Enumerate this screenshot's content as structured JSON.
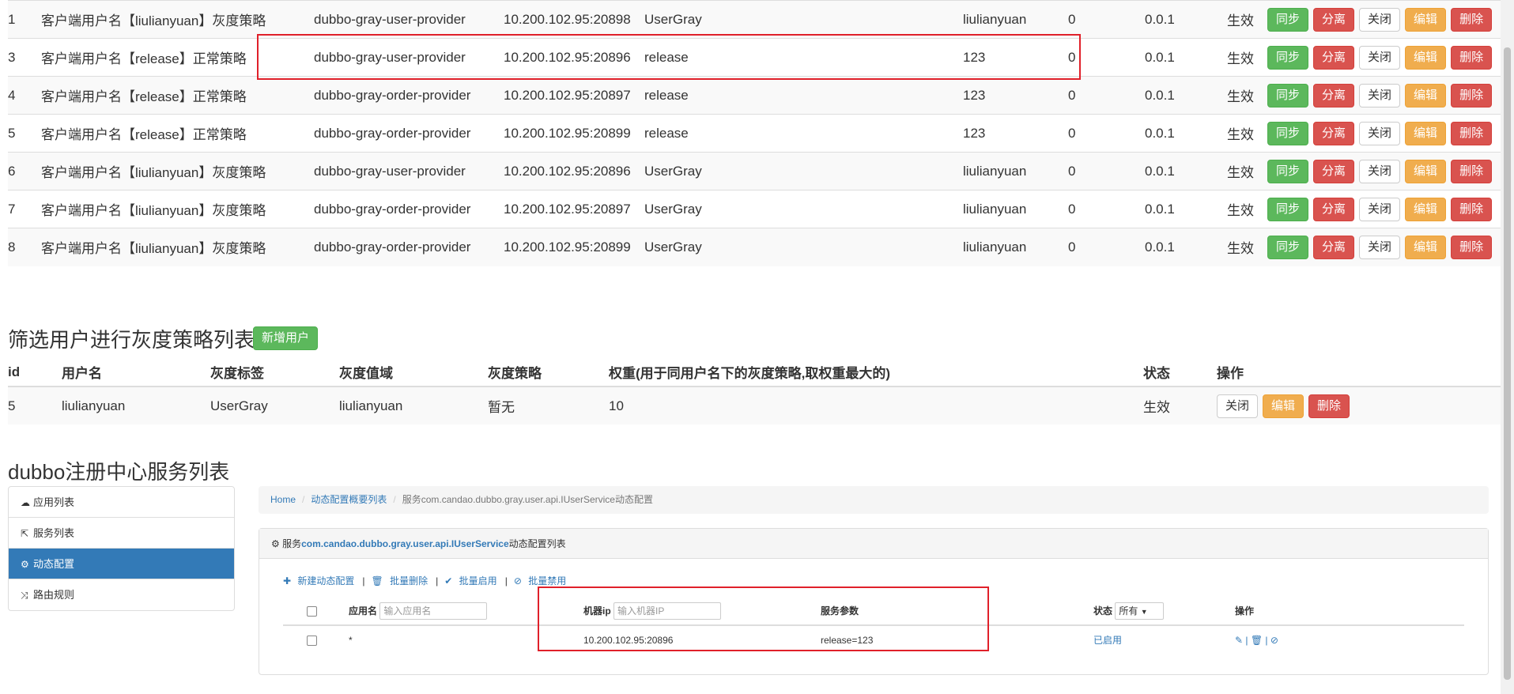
{
  "strategy_rows": [
    {
      "id": "1",
      "name": "客户端用户名【liulianyuan】灰度策略",
      "service": "dubbo-gray-user-provider",
      "address": "10.200.102.95:20898",
      "tag": "UserGray",
      "value": "liulianyuan",
      "weight": "0",
      "version": "0.0.1",
      "status": "生效"
    },
    {
      "id": "3",
      "name": "客户端用户名【release】正常策略",
      "service": "dubbo-gray-user-provider",
      "address": "10.200.102.95:20896",
      "tag": "release",
      "value": "123",
      "weight": "0",
      "version": "0.0.1",
      "status": "生效"
    },
    {
      "id": "4",
      "name": "客户端用户名【release】正常策略",
      "service": "dubbo-gray-order-provider",
      "address": "10.200.102.95:20897",
      "tag": "release",
      "value": "123",
      "weight": "0",
      "version": "0.0.1",
      "status": "生效"
    },
    {
      "id": "5",
      "name": "客户端用户名【release】正常策略",
      "service": "dubbo-gray-order-provider",
      "address": "10.200.102.95:20899",
      "tag": "release",
      "value": "123",
      "weight": "0",
      "version": "0.0.1",
      "status": "生效"
    },
    {
      "id": "6",
      "name": "客户端用户名【liulianyuan】灰度策略",
      "service": "dubbo-gray-user-provider",
      "address": "10.200.102.95:20896",
      "tag": "UserGray",
      "value": "liulianyuan",
      "weight": "0",
      "version": "0.0.1",
      "status": "生效"
    },
    {
      "id": "7",
      "name": "客户端用户名【liulianyuan】灰度策略",
      "service": "dubbo-gray-order-provider",
      "address": "10.200.102.95:20897",
      "tag": "UserGray",
      "value": "liulianyuan",
      "weight": "0",
      "version": "0.0.1",
      "status": "生效"
    },
    {
      "id": "8",
      "name": "客户端用户名【liulianyuan】灰度策略",
      "service": "dubbo-gray-order-provider",
      "address": "10.200.102.95:20899",
      "tag": "UserGray",
      "value": "liulianyuan",
      "weight": "0",
      "version": "0.0.1",
      "status": "生效"
    }
  ],
  "row_actions": {
    "sync": "同步",
    "detach": "分离",
    "close": "关闭",
    "edit": "编辑",
    "delete": "删除"
  },
  "users_section": {
    "title": "筛选用户进行灰度策略列表",
    "add_button": "新增用户",
    "headers": [
      "id",
      "用户名",
      "灰度标签",
      "灰度值域",
      "灰度策略",
      "权重(用于同用户名下的灰度策略,取权重最大的)",
      "状态",
      "操作"
    ],
    "row": {
      "id": "5",
      "username": "liulianyuan",
      "tag": "UserGray",
      "value": "liulianyuan",
      "strategy": "暂无",
      "weight": "10",
      "status": "生效"
    },
    "actions": {
      "close": "关闭",
      "edit": "编辑",
      "delete": "删除"
    }
  },
  "registry_section": {
    "title": "dubbo注册中心服务列表",
    "nav": [
      {
        "icon": "cloud-icon",
        "label": "应用列表"
      },
      {
        "icon": "share-icon",
        "label": "服务列表"
      },
      {
        "icon": "cogs-icon",
        "label": "动态配置",
        "active": true
      },
      {
        "icon": "random-icon",
        "label": "路由规则"
      }
    ],
    "breadcrumb": {
      "home": "Home",
      "overview": "动态配置概要列表",
      "current": "服务com.candao.dubbo.gray.user.api.IUserService动态配置"
    },
    "panel": {
      "title_prefix": "服务",
      "title_service": "com.candao.dubbo.gray.user.api.IUserService",
      "title_suffix": "动态配置列表",
      "tools": {
        "new": "新建动态配置",
        "batch_delete": "批量删除",
        "batch_enable": "批量启用",
        "batch_disable": "批量禁用"
      },
      "headers": {
        "app": "应用名",
        "app_placeholder": "输入应用名",
        "ip": "机器ip",
        "ip_placeholder": "输入机器IP",
        "params": "服务参数",
        "status": "状态",
        "status_select": "所有",
        "ops": "操作"
      },
      "row": {
        "app": "*",
        "ip": "10.200.102.95:20896",
        "params": "release=123",
        "status": "已启用"
      }
    }
  }
}
